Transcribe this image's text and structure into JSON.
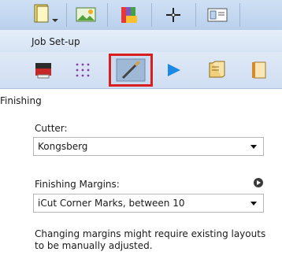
{
  "toolbar": {
    "icons": [
      "document-dropdown-icon",
      "image-icon",
      "color-palette-icon",
      "crosshair-icon",
      "layout-icon"
    ]
  },
  "job_setup": {
    "title": "Job Set-up",
    "icons": [
      "printer-icon",
      "grid-dots-icon",
      "finishing-knife-icon",
      "color-triangle-icon",
      "book-icon",
      "panel-icon"
    ],
    "selected": "finishing-knife-icon"
  },
  "finishing": {
    "section_title": "Finishing",
    "cutter_label": "Cutter:",
    "cutter_value": "Kongsberg",
    "margins_label": "Finishing Margins:",
    "margins_value": "iCut Corner Marks, between 10",
    "note": "Changing margins might require existing layouts to be manually adjusted."
  },
  "colors": {
    "selected_outline": "#d81e1e"
  }
}
